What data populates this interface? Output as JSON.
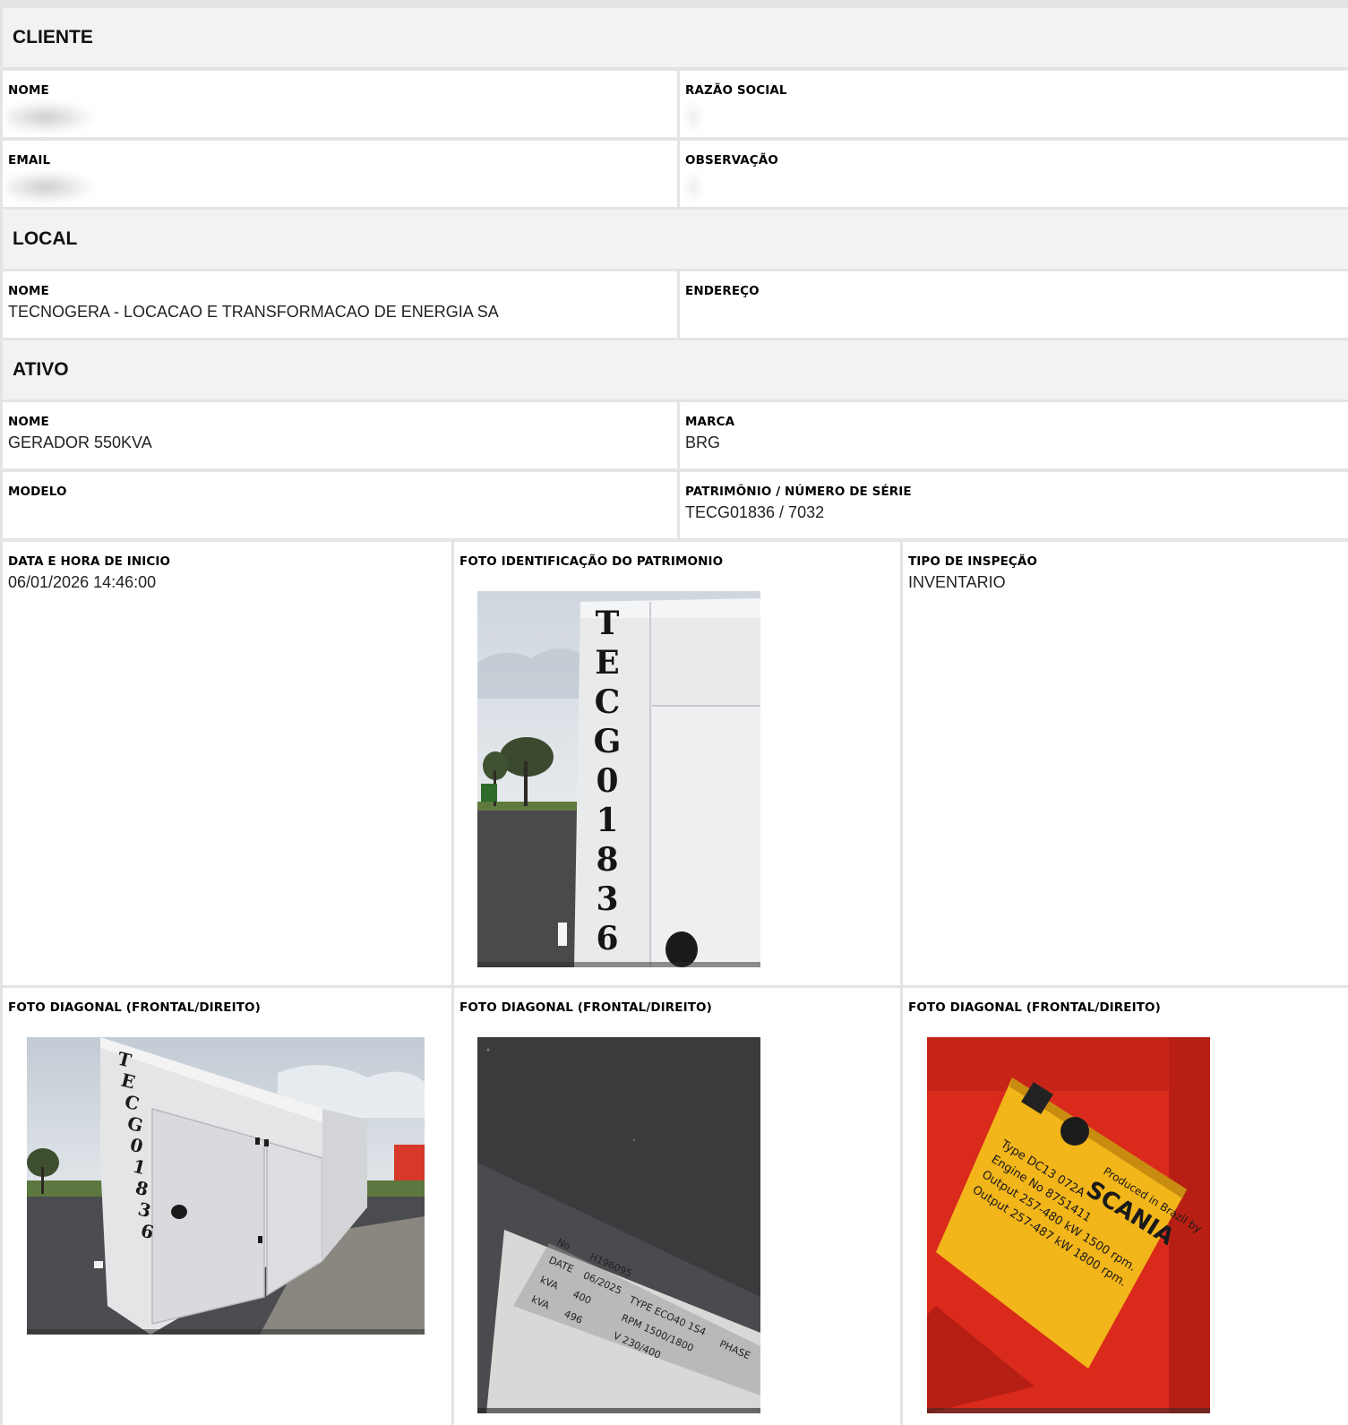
{
  "cliente": {
    "title": "CLIENTE",
    "nome_label": "NOME",
    "razao_label": "RAZÃO SOCIAL",
    "email_label": "EMAIL",
    "observacao_label": "OBSERVAÇÃO"
  },
  "local": {
    "title": "LOCAL",
    "nome_label": "NOME",
    "nome_value": "TECNOGERA - LOCACAO E TRANSFORMACAO DE ENERGIA SA",
    "endereco_label": "ENDEREÇO"
  },
  "ativo": {
    "title": "ATIVO",
    "nome_label": "NOME",
    "nome_value": "GERADOR 550KVA",
    "marca_label": "MARCA",
    "marca_value": "BRG",
    "modelo_label": "MODELO",
    "patrimonio_label": "PATRIMÔNIO / NÚMERO DE SÉRIE",
    "patrimonio_value": "TECG01836 / 7032"
  },
  "inspecao": {
    "data_label": "DATA E HORA DE INICIO",
    "data_value": "06/01/2026 14:46:00",
    "foto_ident_label": "FOTO IDENTIFICAÇÃO DO PATRIMONIO",
    "tipo_label": "TIPO DE INSPEÇÃO",
    "tipo_value": "INVENTARIO",
    "foto_diag_1_label": "FOTO DIAGONAL (FRONTAL/DIREITO)",
    "foto_diag_2_label": "FOTO DIAGONAL (FRONTAL/DIREITO)",
    "foto_diag_3_label": "FOTO DIAGONAL (FRONTAL/DIREITO)"
  },
  "photos": {
    "ident_stencil": "TECG01836",
    "plate_brand": "SCANIA",
    "plate_line1": "Type DC13 072A",
    "plate_line2": "Engine No 8751411",
    "plate_line3": "Output 257-480 kW 1500 rpm.",
    "plate_line4": "Output 257-487 kW 1800 rpm.",
    "plate_line5": "Produced in Brazil by",
    "nameplate_type": "TYPE ECO40 1S4",
    "nameplate_rpm": "RPM 1500/1800",
    "nameplate_v": "V 230/400",
    "nameplate_phase": "PHASE"
  },
  "colors": {
    "header_bg": "#f2f2f2",
    "grid_gap": "#e4e4e4",
    "scania_red": "#d92a1c",
    "plate_yellow": "#f2b51a"
  }
}
